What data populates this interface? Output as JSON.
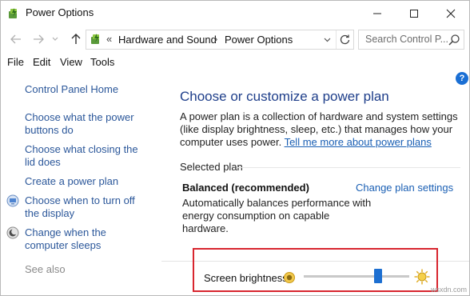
{
  "window": {
    "title": "Power Options",
    "minimize_icon": "minimize-icon",
    "maximize_icon": "maximize-icon",
    "close_icon": "close-icon"
  },
  "address_bar": {
    "breadcrumb_sep": "«",
    "crumbs": [
      "Hardware and Sound",
      "Power Options"
    ],
    "crumb_sep": "›"
  },
  "search": {
    "placeholder": "Search Control P..."
  },
  "menu": [
    "File",
    "Edit",
    "View",
    "Tools"
  ],
  "sidebar": {
    "items": [
      {
        "label": "Control Panel Home"
      },
      {
        "label": "Choose what the power buttons do"
      },
      {
        "label": "Choose what closing the lid does"
      },
      {
        "label": "Create a power plan"
      },
      {
        "label": "Choose when to turn off the display",
        "icon": "display-icon"
      },
      {
        "label": "Change when the computer sleeps",
        "icon": "moon-icon"
      }
    ],
    "see_also": "See also"
  },
  "main": {
    "help_label": "?",
    "title": "Choose or customize a power plan",
    "description": "A power plan is a collection of hardware and system settings (like display brightness, sleep, etc.) that manages how your computer uses power.",
    "learn_more": "Tell me more about power plans",
    "selected_plan_label": "Selected plan",
    "plan_name": "Balanced (recommended)",
    "change_plan": "Change plan settings",
    "plan_description": "Automatically balances performance with energy consumption on capable hardware."
  },
  "brightness": {
    "label": "Screen brightness:",
    "level_percent": 72
  },
  "watermark": "wsxdn.com",
  "colors": {
    "link": "#1a5fb4",
    "title": "#1e3e8a",
    "accent": "#1d6fd1",
    "highlight_box": "#d8262f"
  }
}
